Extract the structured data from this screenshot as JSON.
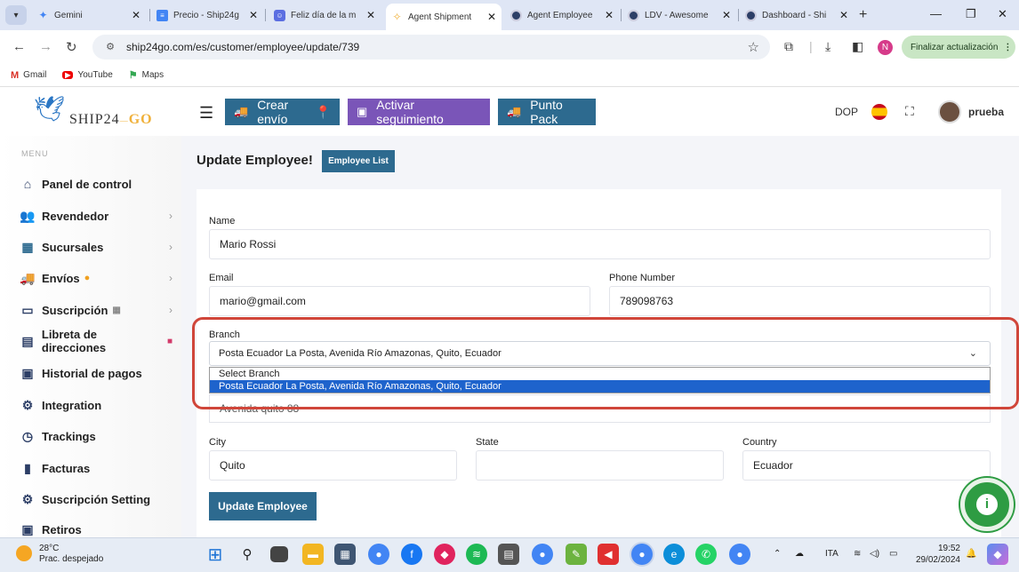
{
  "browser": {
    "tabs": [
      {
        "title": "Gemini",
        "color": "#4285f4"
      },
      {
        "title": "Precio - Ship24g",
        "color": "#4285f4"
      },
      {
        "title": "Feliz día de la m",
        "color": "#5b6ee1"
      },
      {
        "title": "Agent Shipment",
        "color": "#f0b13a"
      },
      {
        "title": "Agent Employee",
        "color": "#2c3e66"
      },
      {
        "title": "LDV - Awesome",
        "color": "#2c3e66"
      },
      {
        "title": "Dashboard - Shi",
        "color": "#2c3e66"
      }
    ],
    "url": "ship24go.com/es/customer/employee/update/739",
    "profile_initial": "N",
    "update_label": "Finalizar actualización",
    "bookmarks": [
      {
        "label": "Gmail",
        "icon": "gmail-icon"
      },
      {
        "label": "YouTube",
        "icon": "youtube-icon"
      },
      {
        "label": "Maps",
        "icon": "maps-icon"
      }
    ]
  },
  "header": {
    "logo_text": "SHIP24",
    "logo_accent": "GO",
    "btn_create": "Crear envío",
    "btn_track": "Activar seguimiento",
    "btn_pack": "Punto Pack",
    "currency": "DOP",
    "user": "prueba",
    "colors": {
      "create": "#2d6a8f",
      "track": "#7a55b8",
      "pack": "#2d6a8f"
    }
  },
  "sidebar": {
    "menu_label": "MENU",
    "items": [
      {
        "label": "Panel de control",
        "icon": "home-icon",
        "chevron": false
      },
      {
        "label": "Revendedor",
        "icon": "users-icon",
        "chevron": true
      },
      {
        "label": "Sucursales",
        "icon": "store-icon",
        "chevron": true
      },
      {
        "label": "Envíos",
        "icon": "truck-icon",
        "chevron": true
      },
      {
        "label": "Suscripción",
        "icon": "card-icon",
        "chevron": true
      },
      {
        "label": "Libreta de direcciones",
        "icon": "address-book-icon",
        "chevron": false
      },
      {
        "label": "Historial de pagos",
        "icon": "money-icon",
        "chevron": false
      },
      {
        "label": "Integration",
        "icon": "gear-icon",
        "chevron": false
      },
      {
        "label": "Trackings",
        "icon": "clock-icon",
        "chevron": false
      },
      {
        "label": "Facturas",
        "icon": "file-icon",
        "chevron": false
      },
      {
        "label": "Suscripción Setting",
        "icon": "gear-icon",
        "chevron": false
      },
      {
        "label": "Retiros",
        "icon": "money-icon",
        "chevron": false
      }
    ]
  },
  "main": {
    "title": "Update Employee!",
    "employee_list_btn": "Employee List",
    "form": {
      "name_label": "Name",
      "name_value": "Mario Rossi",
      "email_label": "Email",
      "email_value": "mario@gmail.com",
      "phone_label": "Phone Number",
      "phone_value": "789098763",
      "branch_label": "Branch",
      "branch_value": "Posta Ecuador La Posta, Avenida Río Amazonas, Quito, Ecuador",
      "branch_options": [
        "Select Branch",
        "Posta Ecuador La Posta, Avenida Río Amazonas, Quito, Ecuador"
      ],
      "address_value": "Avenida quito 88",
      "city_label": "City",
      "city_value": "Quito",
      "state_label": "State",
      "state_value": "",
      "country_label": "Country",
      "country_value": "Ecuador",
      "submit_label": "Update Employee"
    }
  },
  "taskbar": {
    "temp": "28°C",
    "weather": "Prac. despejado",
    "lang": "ITA",
    "time": "19:52",
    "date": "29/02/2024"
  }
}
